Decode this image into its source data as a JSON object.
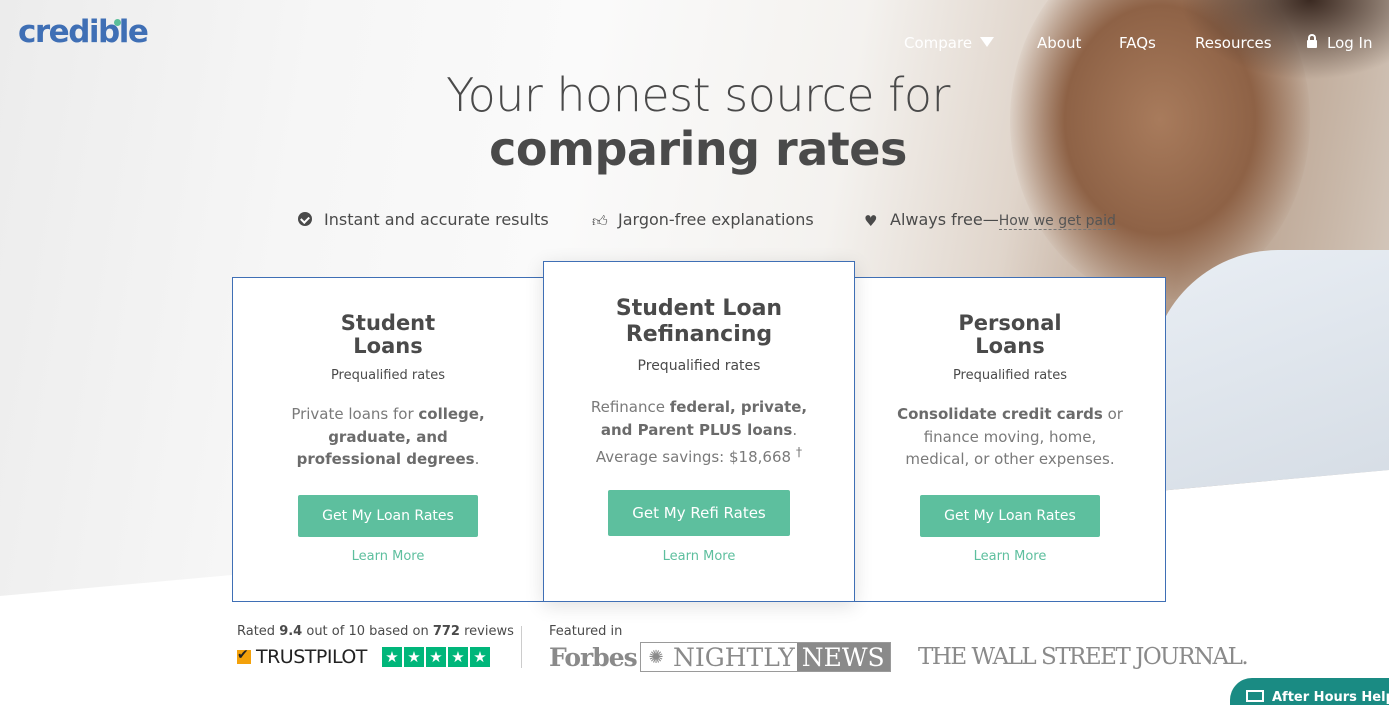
{
  "brand": {
    "logo_text": "credible",
    "accent": "#3f6fb5",
    "green": "#5dbf9e"
  },
  "nav": {
    "compare": "Compare",
    "about": "About",
    "faqs": "FAQs",
    "resources": "Resources",
    "login": "Log In"
  },
  "hero": {
    "headline_line1": "Your honest source for",
    "headline_line2": "comparing rates"
  },
  "features": [
    {
      "icon": "check-circle-icon",
      "text": "Instant and accurate results"
    },
    {
      "icon": "thumbs-up-icon",
      "text": "Jargon-free explanations"
    },
    {
      "icon": "heart-icon",
      "text": "Always free—",
      "link": "How we get paid"
    }
  ],
  "cards": [
    {
      "title_1": "Student",
      "title_2": "Loans",
      "subtitle": "Prequalified rates",
      "desc_pre": "Private loans for ",
      "desc_bold": "college, graduate, and professional degrees",
      "desc_post": ".",
      "button": "Get My Loan Rates",
      "learn": "Learn More"
    },
    {
      "title_1": "Student Loan",
      "title_2": "Refinancing",
      "subtitle": "Prequalified rates",
      "desc_pre": "Refinance ",
      "desc_bold": "federal, private, and Parent PLUS loans",
      "desc_post": ". Average savings: $18,668",
      "desc_sup": "†",
      "button": "Get My Refi Rates",
      "learn": "Learn More"
    },
    {
      "title_1": "Personal",
      "title_2": "Loans",
      "subtitle": "Prequalified rates",
      "desc_pre": "",
      "desc_bold": "Consolidate credit cards",
      "desc_post": " or finance moving, home, medical, or other expenses.",
      "button": "Get My Loan Rates",
      "learn": "Learn More"
    }
  ],
  "trust": {
    "rated": "Rated ",
    "score": "9.4",
    "out_of": " out of 10 based on ",
    "count": "772",
    "reviews": " reviews",
    "trustpilot_label": "TRUSTPILOT",
    "stars": 5
  },
  "press": {
    "featured_in": "Featured in",
    "forbes": "Forbes",
    "nbc_nightly": "NIGHTLY",
    "nbc_news": "NEWS",
    "wsj": "THE WALL STREET JOURNAL."
  },
  "chat": {
    "label": "After Hours Help"
  }
}
